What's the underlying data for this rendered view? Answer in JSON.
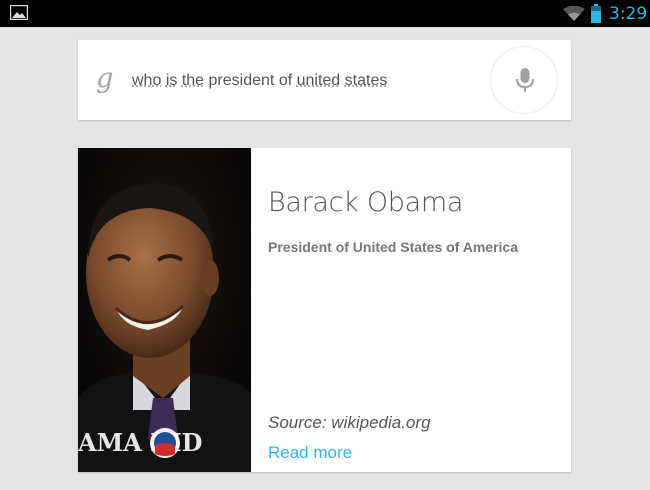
{
  "status_bar": {
    "time": "3:29",
    "notification_icon": "image-thumbnail-icon",
    "wifi_icon": "wifi-icon",
    "battery_icon": "battery-icon",
    "accent_color": "#33b5e5"
  },
  "search": {
    "logo_icon": "google-g-icon",
    "query_words": [
      "who",
      "is",
      "the",
      "president",
      "of",
      "united",
      "states"
    ],
    "mic_icon": "microphone-icon"
  },
  "result": {
    "name": "Barack Obama",
    "description": "President of United States of America",
    "source": "Source: wikipedia.org",
    "read_more_label": "Read more",
    "photo_caption": "AMA BID",
    "photo_icon": "portrait-photo-icon"
  }
}
